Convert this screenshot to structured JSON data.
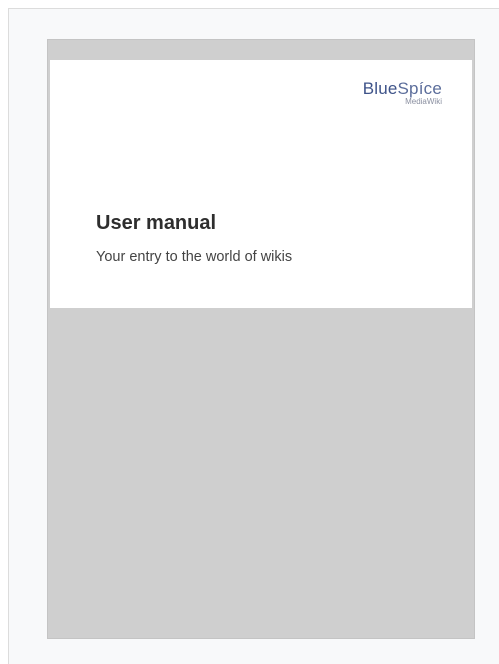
{
  "logo": {
    "brand_part1": "Blue",
    "brand_part2": "Spíce",
    "sub": "MediaWiki"
  },
  "cover": {
    "title": "User manual",
    "subtitle": "Your entry to the world of wikis"
  },
  "colors": {
    "page_background": "#cfcfcf",
    "cover_background": "#ffffff",
    "logo_blue": "#3e5389",
    "title_text": "#2e2e2e"
  }
}
